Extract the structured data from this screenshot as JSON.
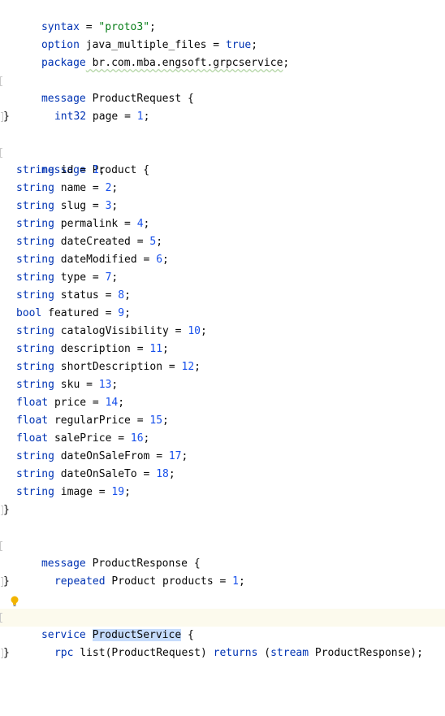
{
  "editor": {
    "syntax_kw": "syntax",
    "syntax_eq": " = ",
    "syntax_val": "\"proto3\"",
    "syntax_end": ";",
    "option_kw": "option",
    "option_name": " java_multiple_files = ",
    "option_val": "true",
    "option_end": ";",
    "package_kw": "package",
    "package_name": " br.com.mba.engsoft.grpcservice",
    "package_end": ";",
    "request": {
      "kw": "message",
      "name": " ProductRequest {",
      "fields": [
        {
          "type": "int32",
          "rest": " page = ",
          "num": "1",
          "end": ";"
        }
      ],
      "close": "}"
    },
    "product": {
      "kw": "message",
      "name": " Product {",
      "fields": [
        {
          "type": "string",
          "rest": " id = ",
          "num": "1",
          "end": ";"
        },
        {
          "type": "string",
          "rest": " name = ",
          "num": "2",
          "end": ";"
        },
        {
          "type": "string",
          "rest": " slug = ",
          "num": "3",
          "end": ";"
        },
        {
          "type": "string",
          "rest": " permalink = ",
          "num": "4",
          "end": ";"
        },
        {
          "type": "string",
          "rest": " dateCreated = ",
          "num": "5",
          "end": ";"
        },
        {
          "type": "string",
          "rest": " dateModified = ",
          "num": "6",
          "end": ";"
        },
        {
          "type": "string",
          "rest": " type = ",
          "num": "7",
          "end": ";"
        },
        {
          "type": "string",
          "rest": " status = ",
          "num": "8",
          "end": ";"
        },
        {
          "type": "bool",
          "rest": " featured = ",
          "num": "9",
          "end": ";"
        },
        {
          "type": "string",
          "rest": " catalogVisibility = ",
          "num": "10",
          "end": ";"
        },
        {
          "type": "string",
          "rest": " description = ",
          "num": "11",
          "end": ";"
        },
        {
          "type": "string",
          "rest": " shortDescription = ",
          "num": "12",
          "end": ";"
        },
        {
          "type": "string",
          "rest": " sku = ",
          "num": "13",
          "end": ";"
        },
        {
          "type": "float",
          "rest": " price = ",
          "num": "14",
          "end": ";"
        },
        {
          "type": "float",
          "rest": " regularPrice = ",
          "num": "15",
          "end": ";"
        },
        {
          "type": "float",
          "rest": " salePrice = ",
          "num": "16",
          "end": ";"
        },
        {
          "type": "string",
          "rest": " dateOnSaleFrom = ",
          "num": "17",
          "end": ";"
        },
        {
          "type": "string",
          "rest": " dateOnSaleTo = ",
          "num": "18",
          "end": ";"
        },
        {
          "type": "string",
          "rest": " image = ",
          "num": "19",
          "end": ";"
        }
      ],
      "close": "}"
    },
    "response": {
      "kw": "message",
      "name": " ProductResponse {",
      "fields": [
        {
          "type": "repeated",
          "rest": " Product products = ",
          "num": "1",
          "end": ";"
        }
      ],
      "close": "}"
    },
    "service": {
      "kw": "service",
      "space": " ",
      "name": "ProductService",
      "brace": " {",
      "rpc_kw": "rpc",
      "rpc_sig": " list(ProductRequest) ",
      "returns_kw": "returns",
      "rpc_open": " (",
      "stream_kw": "stream",
      "rpc_tail": " ProductResponse);",
      "close": "}"
    }
  },
  "colors": {
    "keyword": "#0033b3",
    "string": "#067d17",
    "number": "#1750eb",
    "text": "#080808",
    "highlight": "#c6dcfc",
    "current_line": "#fcfaed",
    "bulb": "#f2b400"
  },
  "icons": {
    "intention": "lightbulb-icon"
  }
}
